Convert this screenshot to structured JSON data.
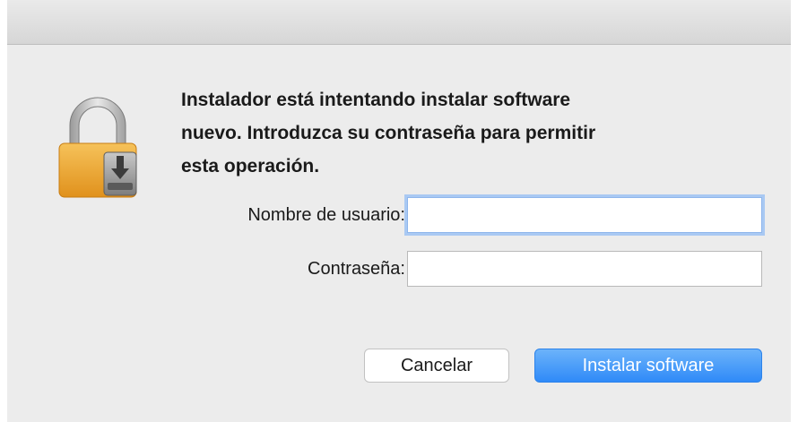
{
  "dialog": {
    "message": "Instalador está intentando instalar software\nnuevo. Introduzca su contraseña para permitir\nesta operación.",
    "icon": "lock-installer-icon"
  },
  "form": {
    "username_label": "Nombre de usuario:",
    "username_value": "",
    "password_label": "Contraseña:",
    "password_value": ""
  },
  "buttons": {
    "cancel_label": "Cancelar",
    "install_label": "Instalar software"
  },
  "colors": {
    "primary_button": "#2f8af8",
    "lock_body": "#f0a32a",
    "focus_ring": "#a9c9f3"
  }
}
